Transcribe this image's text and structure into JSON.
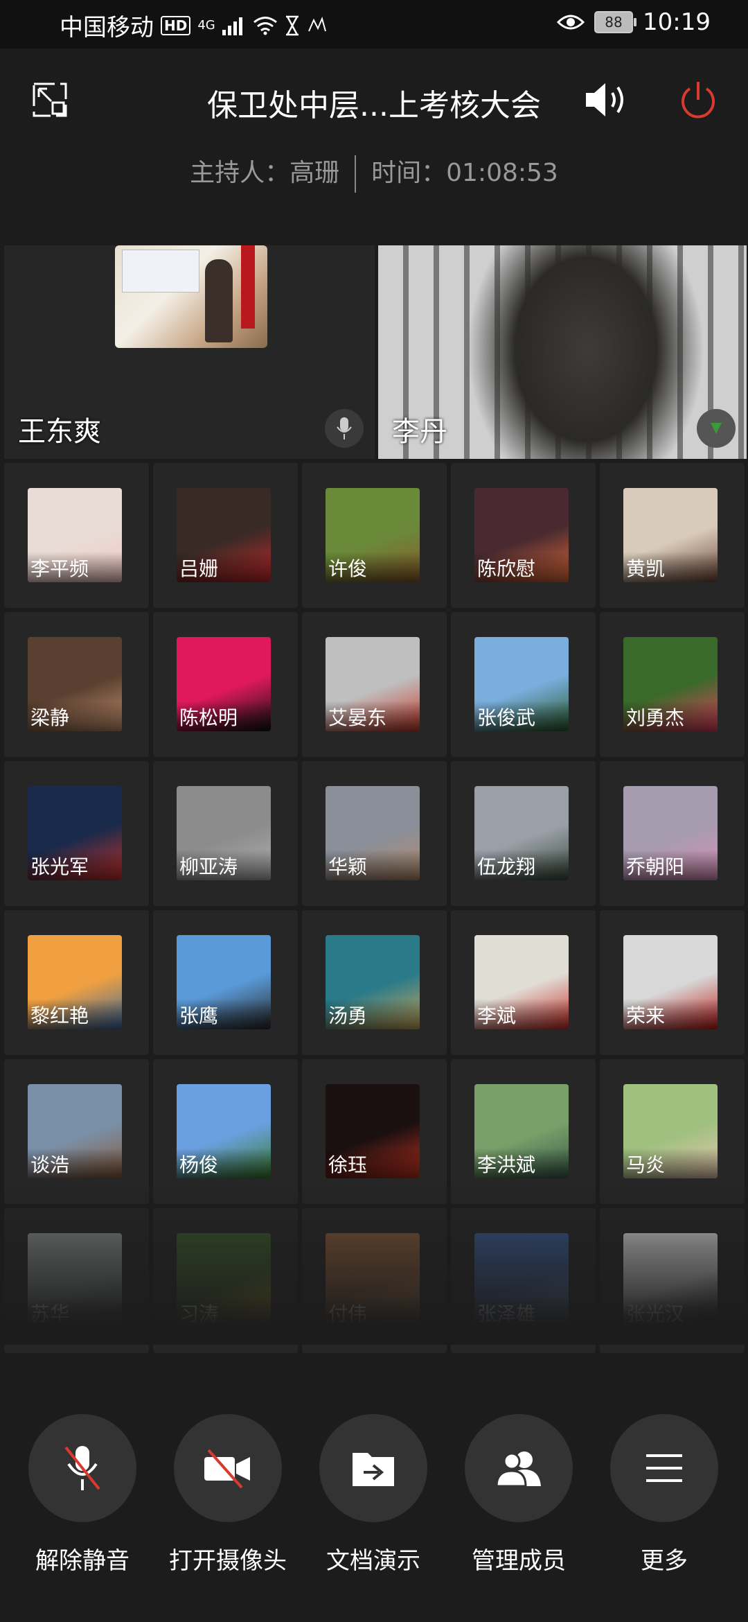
{
  "status_bar": {
    "carrier": "中国移动",
    "hd": "HD",
    "network": "4G",
    "battery": "88",
    "time": "10:19"
  },
  "header": {
    "title": "保卫处中层...上考核大会",
    "host_label": "主持人：高珊",
    "time_label": "时间：01:08:53"
  },
  "videos": [
    {
      "name": "王东爽"
    },
    {
      "name": "李丹"
    }
  ],
  "participants": [
    {
      "name": "李平频",
      "bg": "#e9dcd6",
      "accent": "#f2c7c0"
    },
    {
      "name": "吕姗",
      "bg": "#3a2a26",
      "accent": "#c52a2a"
    },
    {
      "name": "许俊",
      "bg": "#6a8a3a",
      "accent": "#8a5a2a"
    },
    {
      "name": "陈欣慰",
      "bg": "#4a2a30",
      "accent": "#e06a3a"
    },
    {
      "name": "黄凯",
      "bg": "#d9cbbb",
      "accent": "#6e4a3a"
    },
    {
      "name": "梁静",
      "bg": "#5a4030",
      "accent": "#c69270"
    },
    {
      "name": "陈松明",
      "bg": "#e0195c",
      "accent": "#111111"
    },
    {
      "name": "艾晏东",
      "bg": "#bfbfbf",
      "accent": "#c83a2a"
    },
    {
      "name": "张俊武",
      "bg": "#7aaedc",
      "accent": "#2a5a2a"
    },
    {
      "name": "刘勇杰",
      "bg": "#3a6a2a",
      "accent": "#e4415f"
    },
    {
      "name": "张光军",
      "bg": "#1a2a4a",
      "accent": "#c9302a"
    },
    {
      "name": "柳亚涛",
      "bg": "#8c8c8c",
      "accent": "#b0b0b0"
    },
    {
      "name": "华颖",
      "bg": "#8a8f9a",
      "accent": "#b48a6a"
    },
    {
      "name": "伍龙翔",
      "bg": "#9aa0a8",
      "accent": "#3a4a3a"
    },
    {
      "name": "乔朝阳",
      "bg": "#a79bb0",
      "accent": "#d98fb6"
    },
    {
      "name": "黎红艳",
      "bg": "#f0a040",
      "accent": "#3a6aa0"
    },
    {
      "name": "张鹰",
      "bg": "#5a9ad8",
      "accent": "#2a2a2a"
    },
    {
      "name": "汤勇",
      "bg": "#2a7a8a",
      "accent": "#c9a85a"
    },
    {
      "name": "李斌",
      "bg": "#e0ddd5",
      "accent": "#c9302a"
    },
    {
      "name": "荣来",
      "bg": "#d8d8d8",
      "accent": "#c0201a"
    },
    {
      "name": "谈浩",
      "bg": "#7a90a8",
      "accent": "#8a5a3a"
    },
    {
      "name": "杨俊",
      "bg": "#6aa0e0",
      "accent": "#3a7a2a"
    },
    {
      "name": "徐珏",
      "bg": "#1a1010",
      "accent": "#c03020"
    },
    {
      "name": "李洪斌",
      "bg": "#7aa06a",
      "accent": "#3a5a4a"
    },
    {
      "name": "马炎",
      "bg": "#a0c080",
      "accent": "#e8c8b0"
    },
    {
      "name": "苏华",
      "bg": "#8a9090",
      "accent": "#5a6060"
    },
    {
      "name": "习涛",
      "bg": "#3a5a2a",
      "accent": "#e8b820"
    },
    {
      "name": "付伟",
      "bg": "#8a5a3a",
      "accent": "#d0904a"
    },
    {
      "name": "张泽雄",
      "bg": "#3a5a90",
      "accent": "#7a9ac0"
    },
    {
      "name": "张光汉",
      "bg": "#e0e0e0",
      "accent": "#2a2a2a"
    }
  ],
  "toolbar": {
    "unmute": "解除静音",
    "camera": "打开摄像头",
    "share_doc": "文档演示",
    "manage": "管理成员",
    "more": "更多"
  }
}
